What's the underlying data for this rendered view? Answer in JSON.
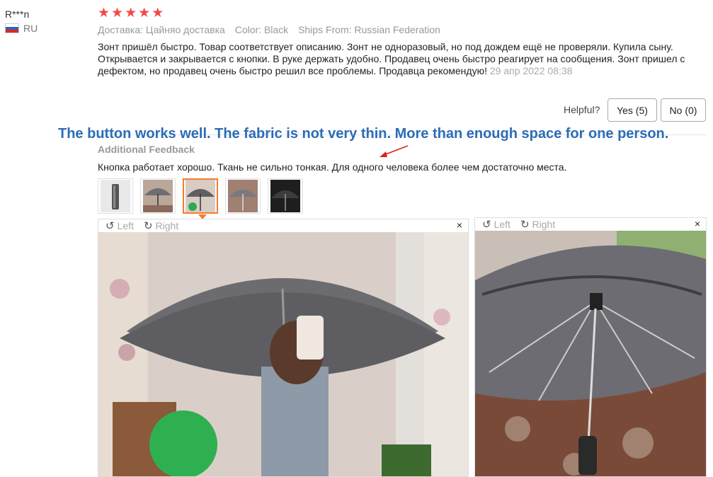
{
  "reviewer": {
    "name": "R***n",
    "country": "RU"
  },
  "rating": {
    "stars": 5
  },
  "meta": {
    "delivery": "Доставка: Цайняо доставка",
    "color": "Color: Black",
    "ships_from": "Ships From: Russian Federation"
  },
  "review": {
    "text": "Зонт пришёл быстро. Товар соответствует описанию. Зонт не одноразовый, но под дождем ещё не проверяли. Купила сыну. Открывается и закрывается с кнопки. В руке держать удобно. Продавец очень быстро реагирует на сообщения. Зонт пришел с дефектом, но продавец очень быстро решил все проблемы. Продавца рекомендую!",
    "date": "29 апр 2022 08:38"
  },
  "helpful": {
    "label": "Helpful?",
    "yes_label": "Yes (5)",
    "no_label": "No (0)"
  },
  "annotation": {
    "text": "The button works well. The fabric is not very thin. More than enough space for one person."
  },
  "additional_feedback": {
    "title": "Additional Feedback",
    "text": "Кнопка работает хорошо. Ткань не сильно тонкая. Для одного человека более чем достаточно места."
  },
  "viewer": {
    "left_label": "Left",
    "right_label": "Right",
    "close_glyph": "×"
  },
  "icons": {
    "rotate_left": "rotate-left-icon",
    "rotate_right": "rotate-right-icon",
    "close": "close-icon",
    "star": "star-icon"
  },
  "colors": {
    "star": "#f04a4a",
    "accent": "#f57c2e",
    "annotation": "#2b6cb8"
  }
}
